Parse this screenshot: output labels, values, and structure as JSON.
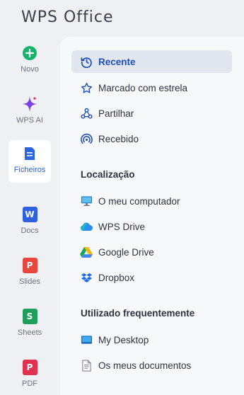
{
  "app": {
    "title": "WPS Office"
  },
  "rail": {
    "items": [
      {
        "label": "Novo",
        "icon": "plus-circle-icon",
        "color": "#16b36a"
      },
      {
        "label": "WPS AI",
        "icon": "sparkle-icon",
        "color": "#7b3fe4"
      },
      {
        "label": "Ficheiros",
        "icon": "files-icon",
        "color": "#2b66e0",
        "active": true
      },
      {
        "label": "Docs",
        "icon": "docs-icon",
        "letter": "W",
        "color": "#3060e0"
      },
      {
        "label": "Slides",
        "icon": "slides-icon",
        "letter": "P",
        "color": "#e8453c"
      },
      {
        "label": "Sheets",
        "icon": "sheets-icon",
        "letter": "S",
        "color": "#1e9e5a"
      },
      {
        "label": "PDF",
        "icon": "pdf-icon",
        "letter": "P",
        "color": "#e0314f"
      }
    ]
  },
  "panel": {
    "top_items": [
      {
        "label": "Recente",
        "icon": "recent-clock-icon",
        "active": true
      },
      {
        "label": "Marcado com estrela",
        "icon": "star-icon"
      },
      {
        "label": "Partilhar",
        "icon": "share-icon"
      },
      {
        "label": "Recebido",
        "icon": "received-icon"
      }
    ],
    "location": {
      "title": "Localização",
      "items": [
        {
          "label": "O meu computador",
          "icon": "computer-icon"
        },
        {
          "label": "WPS Drive",
          "icon": "wps-drive-cloud-icon"
        },
        {
          "label": "Google Drive",
          "icon": "google-drive-icon"
        },
        {
          "label": "Dropbox",
          "icon": "dropbox-icon"
        }
      ]
    },
    "frequent": {
      "title": "Utilizado frequentemente",
      "items": [
        {
          "label": "My Desktop",
          "icon": "desktop-icon"
        },
        {
          "label": "Os meus documentos",
          "icon": "documents-icon"
        }
      ]
    }
  },
  "colors": {
    "accent": "#2563eb",
    "active_bg": "#e1e6ef"
  }
}
